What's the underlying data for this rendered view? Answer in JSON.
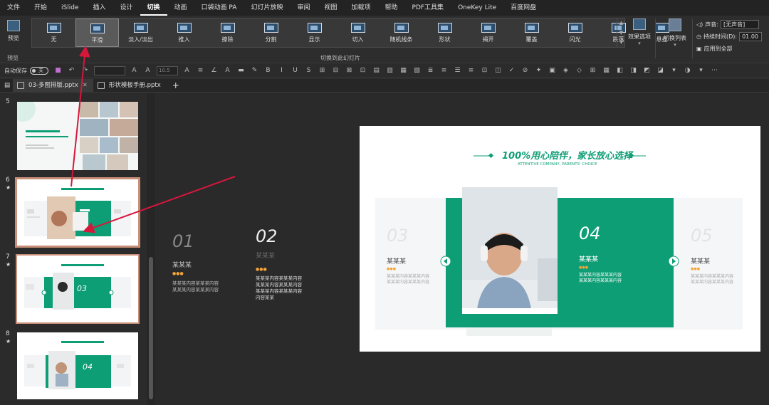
{
  "menu": [
    "文件",
    "开始",
    "iSlide",
    "插入",
    "设计",
    "切换",
    "动画",
    "口袋动画 PA",
    "幻灯片放映",
    "审阅",
    "视图",
    "加载项",
    "帮助",
    "PDF工具集",
    "OneKey Lite",
    "百度网盘"
  ],
  "menu_active": "切换",
  "ribbon": {
    "preview_label": "预览",
    "preview_group": "预览",
    "transitions": [
      "无",
      "平滑",
      "淡入/淡出",
      "推入",
      "擦除",
      "分割",
      "显示",
      "切入",
      "随机线条",
      "形状",
      "揭开",
      "覆盖",
      "闪光",
      "跌落",
      "悬挂"
    ],
    "selected_transition": "平滑",
    "gallery_group": "切换到此幻灯片",
    "effect_options": "效果选项",
    "switch_list": "切换列表",
    "sound_label": "声音:",
    "sound_value": "[无声音]",
    "duration_label": "持续时间(D):",
    "duration_value": "01.00",
    "apply_all": "应用到全部"
  },
  "toolbar": {
    "autosave": "自动保存",
    "autosave_state": "关",
    "font_size": "10.5"
  },
  "tabs": [
    {
      "label": "03-多图排版.pptx",
      "active": true
    },
    {
      "label": "形状模板手册.pptx",
      "active": false
    }
  ],
  "slides": [
    {
      "number": "5",
      "star": "",
      "title": "100%用心陪伴，家长放心选择"
    },
    {
      "number": "6",
      "star": "★",
      "title": "100%用心陪伴，家长放心选择"
    },
    {
      "number": "7",
      "star": "★",
      "title": "100%用心陪伴，家长放心选择",
      "big": "03"
    },
    {
      "number": "8",
      "star": "★",
      "title": "100%用心陪伴，家长放心选择",
      "big": "04"
    }
  ],
  "overflow_items": [
    {
      "num": "01",
      "name": "某某某",
      "dots": "●●●",
      "text": "某某某内容某某某内容\n某某某内容某某某内容"
    },
    {
      "num": "02",
      "name": "某某某",
      "dots": "●●●",
      "text": "某某某内容某某某内容\n某某某内容某某某内容\n某某某内容某某某内容\n内容某某"
    }
  ],
  "main_slide": {
    "title": "100%用心陪伴，家长放心选择",
    "subtitle": "ATTENTIVE COMPANY, PARENTS' CHOICE",
    "cards": [
      {
        "num": "03",
        "name": "某某某",
        "dots": "●●●",
        "text": "某某某内容某某某内容\n某某某内容某某某内容"
      },
      {
        "num": "04",
        "name": "某某某",
        "dots": "●●●",
        "text": "某某某内容某某某内容\n某某某内容某某某内容"
      },
      {
        "num": "05",
        "name": "某某某",
        "dots": "●●●",
        "text": "某某某内容某某某内容\n某某某内容某某某内容"
      }
    ]
  },
  "colors": {
    "accent": "#0e9e75",
    "annotation": "#d6173c",
    "selection": "#c98e77",
    "dots": "#f3a43b"
  },
  "icons": [
    "preview-icon",
    "effect-options-icon",
    "switch-list-icon",
    "sound-icon",
    "clock-icon",
    "apply-all-icon",
    "save-icon",
    "undo-icon",
    "redo-icon",
    "prev-arrow-icon",
    "next-arrow-icon"
  ]
}
